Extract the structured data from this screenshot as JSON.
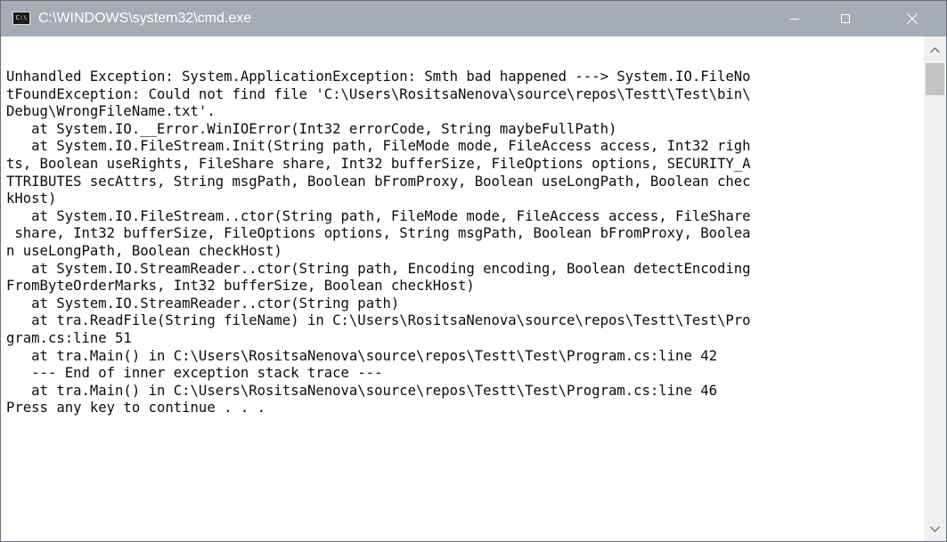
{
  "window": {
    "title": "C:\\WINDOWS\\system32\\cmd.exe",
    "icon_label": "C:\\",
    "icon": "cmd-icon"
  },
  "controls": {
    "minimize_icon": "minimize-icon",
    "maximize_icon": "maximize-icon",
    "close_icon": "close-icon"
  },
  "console": {
    "lines": [
      "Unhandled Exception: System.ApplicationException: Smth bad happened ---> System.IO.FileNo",
      "tFoundException: Could not find file 'C:\\Users\\RositsaNenova\\source\\repos\\Testt\\Test\\bin\\",
      "Debug\\WrongFileName.txt'.",
      "   at System.IO.__Error.WinIOError(Int32 errorCode, String maybeFullPath)",
      "   at System.IO.FileStream.Init(String path, FileMode mode, FileAccess access, Int32 righ",
      "ts, Boolean useRights, FileShare share, Int32 bufferSize, FileOptions options, SECURITY_A",
      "TTRIBUTES secAttrs, String msgPath, Boolean bFromProxy, Boolean useLongPath, Boolean chec",
      "kHost)",
      "   at System.IO.FileStream..ctor(String path, FileMode mode, FileAccess access, FileShare",
      " share, Int32 bufferSize, FileOptions options, String msgPath, Boolean bFromProxy, Boolea",
      "n useLongPath, Boolean checkHost)",
      "   at System.IO.StreamReader..ctor(String path, Encoding encoding, Boolean detectEncoding",
      "FromByteOrderMarks, Int32 bufferSize, Boolean checkHost)",
      "   at System.IO.StreamReader..ctor(String path)",
      "   at tra.ReadFile(String fileName) in C:\\Users\\RositsaNenova\\source\\repos\\Testt\\Test\\Pro",
      "gram.cs:line 51",
      "   at tra.Main() in C:\\Users\\RositsaNenova\\source\\repos\\Testt\\Test\\Program.cs:line 42",
      "   --- End of inner exception stack trace ---",
      "   at tra.Main() in C:\\Users\\RositsaNenova\\source\\repos\\Testt\\Test\\Program.cs:line 46",
      "Press any key to continue . . ."
    ]
  },
  "scrollbar": {
    "up_icon": "scroll-up-arrow-icon",
    "down_icon": "scroll-down-arrow-icon"
  }
}
